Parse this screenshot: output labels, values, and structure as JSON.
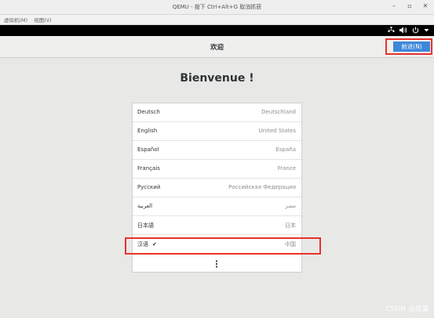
{
  "window": {
    "title": "QEMU - 按下 Ctrl+Alt+G 取消抓获",
    "minimize_icon": "minimize-icon",
    "restore_icon": "restore-icon",
    "close_icon": "close-icon"
  },
  "menubar": {
    "items": [
      "虚拟机(M)",
      "视图(V)"
    ]
  },
  "topbar": {
    "icons": [
      "network-icon",
      "volume-icon",
      "power-icon",
      "chevron-down-icon"
    ]
  },
  "header": {
    "title": "欢迎",
    "next_label": "前进(N)"
  },
  "welcome_heading": "Bienvenue !",
  "languages": [
    {
      "name": "Deutsch",
      "region": "Deutschland",
      "selected": false
    },
    {
      "name": "English",
      "region": "United States",
      "selected": false
    },
    {
      "name": "Español",
      "region": "España",
      "selected": false
    },
    {
      "name": "Français",
      "region": "France",
      "selected": false
    },
    {
      "name": "Русский",
      "region": "Российская Федерация",
      "selected": false
    },
    {
      "name": "العربية",
      "region": "مصر",
      "selected": false
    },
    {
      "name": "日本語",
      "region": "日本",
      "selected": false
    },
    {
      "name": "汉语",
      "region": "中国",
      "selected": true,
      "check": "✔"
    }
  ],
  "more_icon": "more-vertical-icon",
  "watermark": "CSDN @庞豪",
  "colors": {
    "accent": "#3d87d8",
    "highlight_box": "#e8312c"
  }
}
